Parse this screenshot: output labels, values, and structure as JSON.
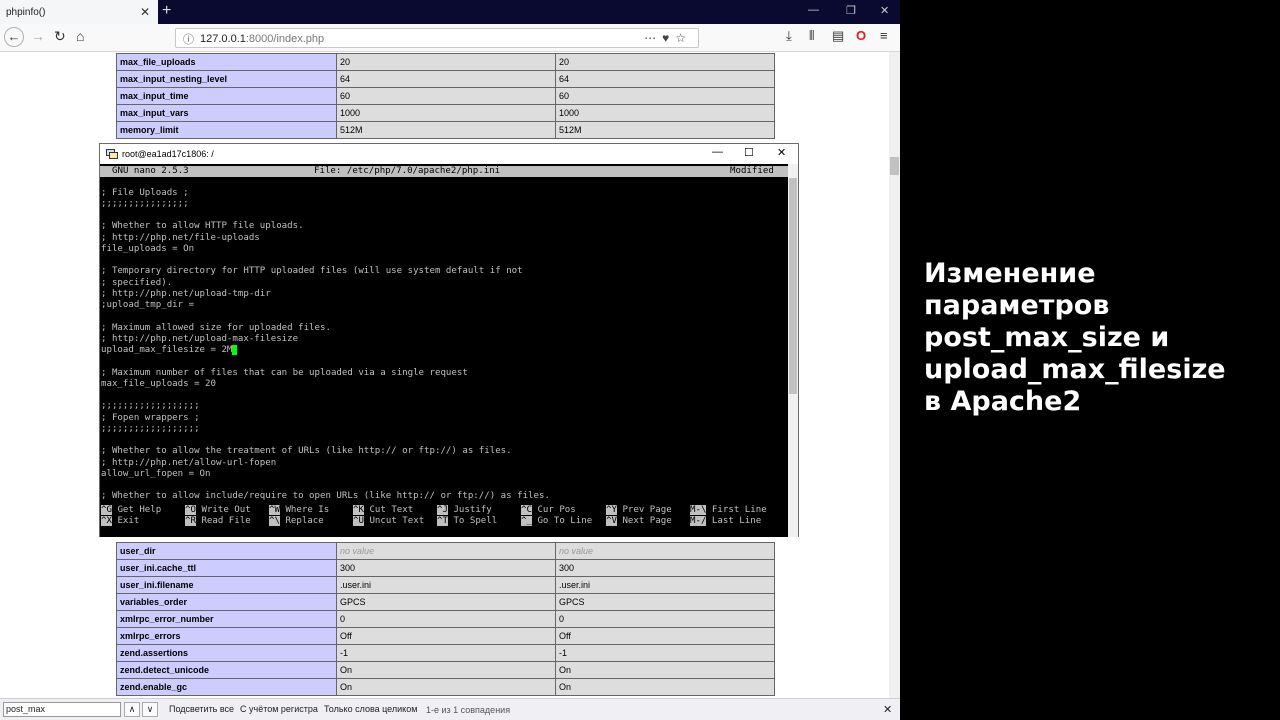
{
  "browser": {
    "tab_title": "phpinfo()",
    "url_host": "127.0.0.1",
    "url_rest": ":8000/index.php"
  },
  "php_table_top": [
    [
      "max_file_uploads",
      "20",
      "20"
    ],
    [
      "max_input_nesting_level",
      "64",
      "64"
    ],
    [
      "max_input_time",
      "60",
      "60"
    ],
    [
      "max_input_vars",
      "1000",
      "1000"
    ],
    [
      "memory_limit",
      "512M",
      "512M"
    ]
  ],
  "php_table_bottom": [
    [
      "user_dir",
      "no value",
      "no value"
    ],
    [
      "user_ini.cache_ttl",
      "300",
      "300"
    ],
    [
      "user_ini.filename",
      ".user.ini",
      ".user.ini"
    ],
    [
      "variables_order",
      "GPCS",
      "GPCS"
    ],
    [
      "xmlrpc_error_number",
      "0",
      "0"
    ],
    [
      "xmlrpc_errors",
      "Off",
      "Off"
    ],
    [
      "zend.assertions",
      "-1",
      "-1"
    ],
    [
      "zend.detect_unicode",
      "On",
      "On"
    ],
    [
      "zend.enable_gc",
      "On",
      "On"
    ]
  ],
  "terminal": {
    "title": "root@ea1ad17c1806: /",
    "nano_version": "GNU nano 2.5.3",
    "nano_file": "File: /etc/php/7.0/apache2/php.ini",
    "nano_status": "Modified",
    "lines": [
      "; File Uploads ;",
      ";;;;;;;;;;;;;;;;",
      "",
      "; Whether to allow HTTP file uploads.",
      "; http://php.net/file-uploads",
      "file_uploads = On",
      "",
      "; Temporary directory for HTTP uploaded files (will use system default if not",
      "; specified).",
      "; http://php.net/upload-tmp-dir",
      ";upload_tmp_dir =",
      "",
      "; Maximum allowed size for uploaded files.",
      "; http://php.net/upload-max-filesize",
      "upload_max_filesize = 2M",
      "",
      "; Maximum number of files that can be uploaded via a single request",
      "max_file_uploads = 20",
      "",
      ";;;;;;;;;;;;;;;;;;",
      "; Fopen wrappers ;",
      ";;;;;;;;;;;;;;;;;;",
      "",
      "; Whether to allow the treatment of URLs (like http:// or ftp://) as files.",
      "; http://php.net/allow-url-fopen",
      "allow_url_fopen = On",
      "",
      "; Whether to allow include/require to open URLs (like http:// or ftp://) as files."
    ],
    "shortcuts_row1": [
      {
        "key": "^G",
        "label": "Get Help"
      },
      {
        "key": "^O",
        "label": "Write Out"
      },
      {
        "key": "^W",
        "label": "Where Is"
      },
      {
        "key": "^K",
        "label": "Cut Text"
      },
      {
        "key": "^J",
        "label": "Justify"
      },
      {
        "key": "^C",
        "label": "Cur Pos"
      },
      {
        "key": "^Y",
        "label": "Prev Page"
      },
      {
        "key": "M-\\",
        "label": "First Line"
      }
    ],
    "shortcuts_row2": [
      {
        "key": "^X",
        "label": "Exit"
      },
      {
        "key": "^R",
        "label": "Read File"
      },
      {
        "key": "^\\",
        "label": "Replace"
      },
      {
        "key": "^U",
        "label": "Uncut Text"
      },
      {
        "key": "^T",
        "label": "To Spell"
      },
      {
        "key": "^_",
        "label": "Go To Line"
      },
      {
        "key": "^V",
        "label": "Next Page"
      },
      {
        "key": "M-/",
        "label": "Last Line"
      }
    ]
  },
  "findbar": {
    "query": "post_max",
    "highlight_all": "Подсветить все",
    "match_case": "С учётом регистра",
    "whole_words": "Только слова целиком",
    "status": "1-е из 1 совпадения"
  },
  "headline": {
    "lines": [
      "Изменение",
      "параметров",
      "post_max_size и",
      "upload_max_filesize",
      "в Apache2"
    ]
  }
}
